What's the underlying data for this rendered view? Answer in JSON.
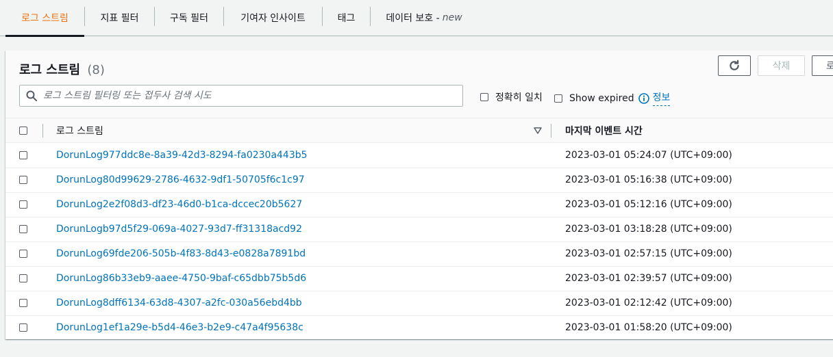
{
  "tabs": [
    {
      "label": "로그 스트림",
      "suffix": ""
    },
    {
      "label": "지표 필터",
      "suffix": ""
    },
    {
      "label": "구독 필터",
      "suffix": ""
    },
    {
      "label": "기여자 인사이트",
      "suffix": ""
    },
    {
      "label": "태그",
      "suffix": ""
    },
    {
      "label": "데이터 보호 -",
      "suffix": "new"
    }
  ],
  "panel": {
    "title": "로그 스트림",
    "count": "(8)",
    "delete_label": "삭제",
    "third_button_label": "로"
  },
  "search": {
    "placeholder": "로그 스트림 필터링 또는 접두사 검색 시도"
  },
  "options": {
    "exact_match_label": "정확히 일치",
    "show_expired_label": "Show expired",
    "info_label": "정보"
  },
  "table": {
    "headers": [
      "로그 스트림",
      "마지막 이벤트 시간"
    ],
    "rows": [
      {
        "name": "DorunLog977ddc8e-8a39-42d3-8294-fa0230a443b5",
        "time": "2023-03-01 05:24:07 (UTC+09:00)"
      },
      {
        "name": "DorunLog80d99629-2786-4632-9df1-50705f6c1c97",
        "time": "2023-03-01 05:16:38 (UTC+09:00)"
      },
      {
        "name": "DorunLog2e2f08d3-df23-46d0-b1ca-dccec20b5627",
        "time": "2023-03-01 05:12:16 (UTC+09:00)"
      },
      {
        "name": "DorunLogb97d5f29-069a-4027-93d7-ff31318acd92",
        "time": "2023-03-01 03:18:28 (UTC+09:00)"
      },
      {
        "name": "DorunLog69fde206-505b-4f83-8d43-e0828a7891bd",
        "time": "2023-03-01 02:57:15 (UTC+09:00)"
      },
      {
        "name": "DorunLog86b33eb9-aaee-4750-9baf-c65dbb75b5d6",
        "time": "2023-03-01 02:39:57 (UTC+09:00)"
      },
      {
        "name": "DorunLog8dff6134-63d8-4307-a2fc-030a56ebd4bb",
        "time": "2023-03-01 02:12:42 (UTC+09:00)"
      },
      {
        "name": "DorunLog1ef1a29e-b5d4-46e3-b2e9-c47a4f95638c",
        "time": "2023-03-01 01:58:20 (UTC+09:00)"
      }
    ]
  },
  "colors": {
    "accent": "#ec7211",
    "link": "#0073bb"
  }
}
